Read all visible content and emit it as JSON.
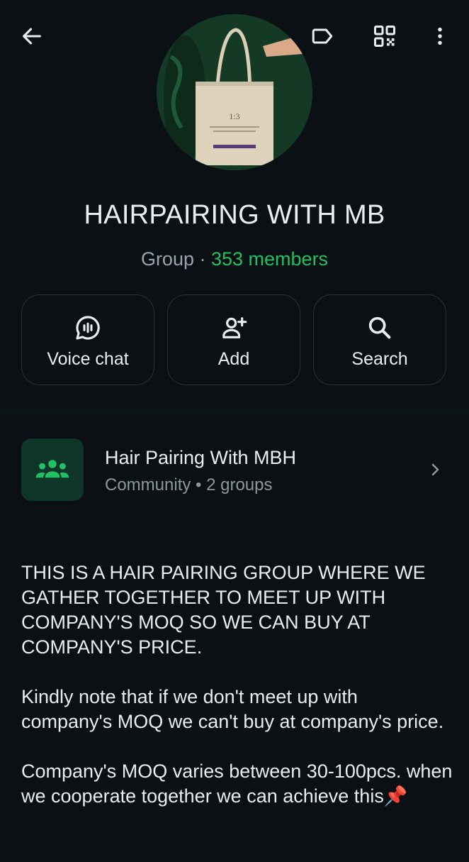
{
  "header": {
    "back_icon": "arrow-left-icon",
    "label_icon": "label-tag-icon",
    "qr_icon": "qr-code-icon",
    "more_icon": "more-vertical-icon"
  },
  "group": {
    "name": "HAIRPAIRING WITH MB",
    "type": "Group",
    "separator": " · ",
    "members": "353 members",
    "avatar_text": "1:3"
  },
  "actions": [
    {
      "label": "Voice chat",
      "icon": "voice-chat-icon"
    },
    {
      "label": "Add",
      "icon": "add-person-icon"
    },
    {
      "label": "Search",
      "icon": "search-icon"
    }
  ],
  "community": {
    "title": "Hair Pairing With MBH",
    "subtitle": "Community • 2 groups",
    "icon": "community-icon"
  },
  "description": {
    "paragraphs": [
      "THIS IS A HAIR PAIRING GROUP WHERE WE GATHER TOGETHER TO MEET UP WITH COMPANY'S MOQ SO WE CAN BUY AT COMPANY'S PRICE.",
      "Kindly note that if we don't meet up with company's MOQ we can't buy at company's price.",
      "Company's MOQ varies between 30-100pcs. when we cooperate together we can achieve this📌"
    ]
  },
  "colors": {
    "background": "#0b1014",
    "accent_green": "#21c063",
    "text_muted": "#9aa4aa"
  }
}
